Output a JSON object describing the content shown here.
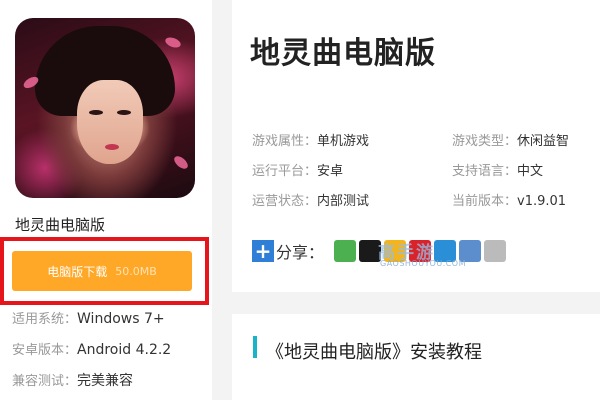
{
  "app": {
    "name": "地灵曲电脑版",
    "download_label": "电脑版下载",
    "download_size": "50.0MB"
  },
  "meta": [
    {
      "key": "适用系统：",
      "value": "Windows 7+"
    },
    {
      "key": "安卓版本：",
      "value": "Android 4.2.2"
    },
    {
      "key": "兼容测试：",
      "value": "完美兼容"
    }
  ],
  "detail": {
    "title": "地灵曲电脑版",
    "attributes": [
      {
        "key": "游戏属性：",
        "value": "单机游戏"
      },
      {
        "key": "游戏类型：",
        "value": "休闲益智"
      },
      {
        "key": "运行平台：",
        "value": "安卓"
      },
      {
        "key": "支持语言：",
        "value": "中文"
      },
      {
        "key": "运营状态：",
        "value": "内部测试"
      },
      {
        "key": "当前版本：",
        "value": "v1.9.01"
      }
    ],
    "share_label": "分享：",
    "share_icons": [
      "wechat-icon",
      "qq-icon",
      "qzone-icon",
      "weibo-icon",
      "tencent-weibo-icon",
      "print-icon",
      "copy-icon"
    ],
    "share_colors": [
      "#4caf50",
      "#1a1a1a",
      "#f2b51f",
      "#d8232a",
      "#2a8fd6",
      "#5c8dcc",
      "#bbbbbb"
    ],
    "watermark": "高手游",
    "watermark_sub": "GAOSHOUYOU.COM"
  },
  "section": {
    "title": "《地灵曲电脑版》安装教程"
  },
  "colors": {
    "download_button": "#ffa726",
    "highlight_frame": "#e6141b",
    "section_accent": "#1bb3c9",
    "share_plus": "#2f7fd6"
  }
}
